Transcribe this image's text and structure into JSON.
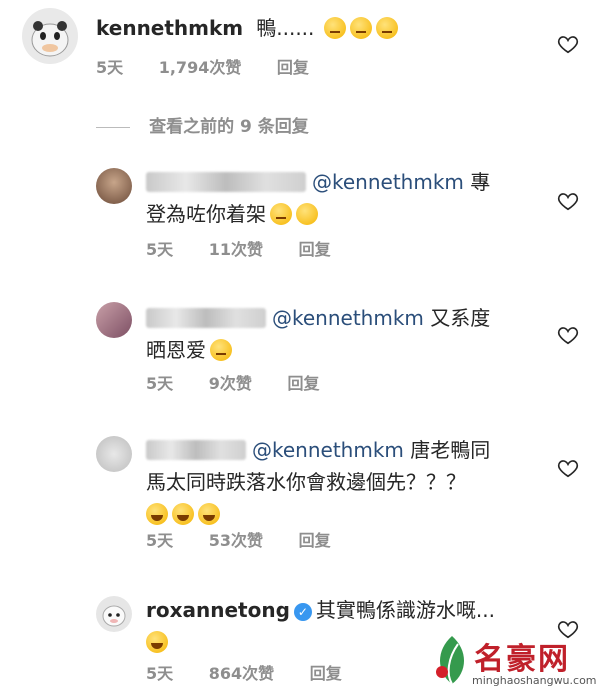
{
  "comments": [
    {
      "user": "kennethmkm",
      "text": "鴨......",
      "emojis": 3,
      "time": "5天",
      "likes": "1,794次赞",
      "reply": "回复"
    },
    {
      "mention": "@kennethmkm",
      "text1": "專",
      "text2": "登為咗你着架",
      "time": "5天",
      "likes": "11次赞",
      "reply": "回复"
    },
    {
      "mention": "@kennethmkm",
      "text1": "又系度",
      "text2": "晒恩爱",
      "time": "5天",
      "likes": "9次赞",
      "reply": "回复"
    },
    {
      "mention": "@kennethmkm",
      "text1": "唐老鴨同",
      "text2": "馬太同時跌落水你會救邊個先？？？",
      "time": "5天",
      "likes": "53次赞",
      "reply": "回复"
    },
    {
      "user": "roxannetong",
      "text": "其實鴨係識游水嘅...",
      "time": "5天",
      "likes": "864次赞",
      "reply": "回复"
    }
  ],
  "view_previous": "查看之前的 9 条回复",
  "watermark": {
    "brand": "名豪网",
    "url": "minghaoshangwu.com"
  },
  "colors": {
    "mention": "#2b4e7a",
    "meta": "#8e8e8e",
    "brand": "#c0202a"
  }
}
